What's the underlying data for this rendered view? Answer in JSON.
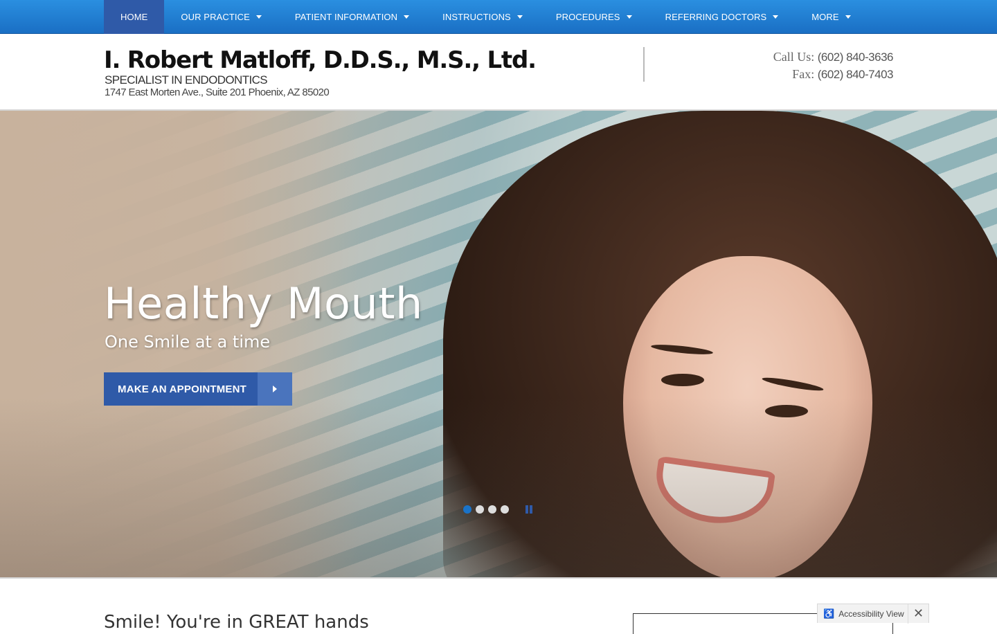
{
  "nav": {
    "items": [
      {
        "label": "HOME",
        "active": true,
        "has_dropdown": false
      },
      {
        "label": "OUR PRACTICE",
        "has_dropdown": true
      },
      {
        "label": "PATIENT INFORMATION",
        "has_dropdown": true
      },
      {
        "label": "INSTRUCTIONS",
        "has_dropdown": true
      },
      {
        "label": "PROCEDURES",
        "has_dropdown": true
      },
      {
        "label": "REFERRING DOCTORS",
        "has_dropdown": true
      },
      {
        "label": "MORE",
        "has_dropdown": true
      }
    ],
    "colors": {
      "bar": "#1a6fc4",
      "active": "#2f5aa8"
    }
  },
  "header": {
    "practice_name": "I. Robert Matloff, D.D.S., M.S., Ltd.",
    "specialty": "SPECIALIST IN ENDODONTICS",
    "address": "1747 East Morten Ave., Suite 201 Phoenix, AZ 85020",
    "call_label": "Call Us:",
    "call_number": "(602) 840-3636",
    "fax_label": "Fax:",
    "fax_number": "(602) 840-7403"
  },
  "hero": {
    "title": "Healthy Mouth",
    "subtitle": "One Smile at a time",
    "cta_label": "MAKE AN APPOINTMENT",
    "cta_icon": "chevron-right-icon",
    "slides": 4,
    "active_slide": 1,
    "pause_icon": "pause-icon"
  },
  "intro": {
    "heading": "Smile! You're in GREAT hands"
  },
  "accessibility": {
    "label": "Accessibility View",
    "icon": "accessibility-icon",
    "close_icon": "close-icon"
  }
}
